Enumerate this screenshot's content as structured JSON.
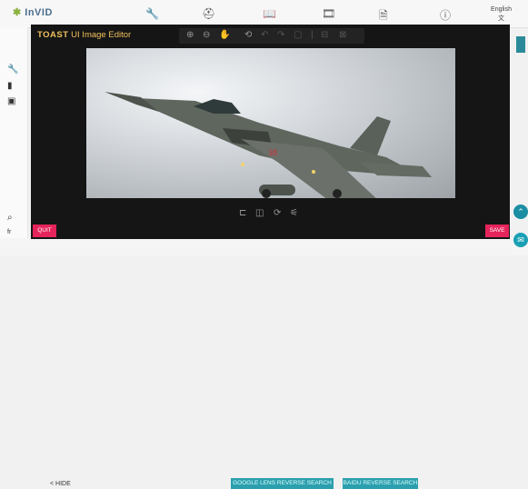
{
  "app": {
    "logo_text": "InVID",
    "lang": "English",
    "lang_icon": "translate-icon"
  },
  "top_icons": [
    "wrench-icon",
    "robot-icon",
    "book-icon",
    "film-icon",
    "document-icon",
    "info-icon"
  ],
  "editor": {
    "title_brand": "TOAST",
    "title_rest": " UI Image Editor",
    "top_tools": [
      "zoom-in-icon",
      "zoom-out-icon",
      "hand-icon",
      "history-icon",
      "undo-icon",
      "redo-icon",
      "reset-icon",
      "delete-icon",
      "delete-all-icon"
    ],
    "bottom_tools": [
      "crop-icon",
      "flip-icon",
      "rotate-icon",
      "filter-icon"
    ],
    "quit_label": "QUIT",
    "save_label": "SAVE",
    "image_alt": "fighter jet"
  },
  "sidebar_icons": [
    "wrench-icon",
    "film-icon",
    "image-icon",
    "search-icon"
  ],
  "sidebar_text": {
    "fr_label": "fr"
  },
  "bottom": {
    "hide_label": "< HIDE",
    "google_label": "GOOGLE LENS REVERSE SEARCH",
    "baidu_label": "BAIDU REVERSE SEARCH"
  },
  "colors": {
    "accent_pink": "#e5245b",
    "teal": "#2b9fae",
    "brand_yellow": "#f0c15a"
  }
}
